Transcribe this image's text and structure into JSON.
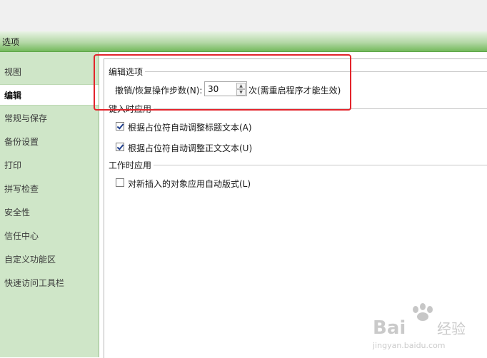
{
  "window": {
    "title": "选项"
  },
  "sidebar": {
    "items": [
      {
        "label": "视图",
        "active": false
      },
      {
        "label": "编辑",
        "active": true
      },
      {
        "label": "常规与保存",
        "active": false
      },
      {
        "label": "备份设置",
        "active": false
      },
      {
        "label": "打印",
        "active": false
      },
      {
        "label": "拼写检查",
        "active": false
      },
      {
        "label": "安全性",
        "active": false
      },
      {
        "label": "信任中心",
        "active": false
      },
      {
        "label": "自定义功能区",
        "active": false
      },
      {
        "label": "快速访问工具栏",
        "active": false
      }
    ]
  },
  "editing": {
    "header": "编辑选项",
    "undo_label": "撤销/恢复操作步数(N):",
    "undo_value": "30",
    "undo_note": "次(需重启程序才能生效)"
  },
  "on_type": {
    "header": "键入时应用",
    "options": [
      {
        "label": "根据占位符自动调整标题文本(A)",
        "checked": true
      },
      {
        "label": "根据占位符自动调整正文文本(U)",
        "checked": true
      }
    ]
  },
  "on_work": {
    "header": "工作时应用",
    "options": [
      {
        "label": "对新插入的对象应用自动版式(L)",
        "checked": false
      }
    ]
  },
  "watermark": {
    "brand": "Bai",
    "brand2": "经验",
    "url": "jingyan.baidu.com"
  },
  "colors": {
    "highlight": "#e3242b",
    "sidebar": "#cfe6c8",
    "titlebar": "#74b95c"
  }
}
